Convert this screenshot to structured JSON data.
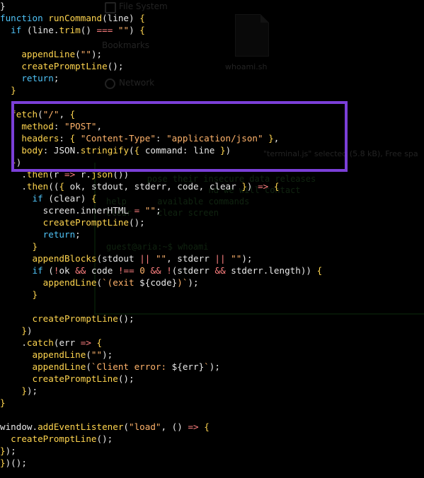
{
  "background_window": {
    "sidebar": {
      "file_system_label": "File System",
      "bookmarks_label": "Bookmarks",
      "network_label": "Network"
    },
    "file_icon_name": "whoami.sh",
    "status_text": "\"terminal.js\" selected (5.8 kB), Free spa",
    "terminal_lines": [
      "        pose their insecure data releases",
      "                    nd we will contact",
      "help      available commands",
      "clear     clear screen",
      "",
      "guest@aria:~$ whoami"
    ]
  },
  "highlight": {
    "color": "#7b3fd8",
    "label": "fetch-call-highlight"
  },
  "code_lines": [
    [
      [
        "p",
        "}"
      ]
    ],
    [
      [
        "kw",
        "function "
      ],
      [
        "fn",
        "runCommand"
      ],
      [
        "p",
        "("
      ],
      [
        "pl",
        "line"
      ],
      [
        "p",
        ") "
      ],
      [
        "br",
        "{"
      ]
    ],
    [
      [
        "p",
        "  "
      ],
      [
        "kw",
        "if "
      ],
      [
        "p",
        "("
      ],
      [
        "pl",
        "line"
      ],
      [
        "p",
        "."
      ],
      [
        "fn",
        "trim"
      ],
      [
        "p",
        "() "
      ],
      [
        "op",
        "==="
      ],
      [
        "p",
        " "
      ],
      [
        "str",
        "\"\""
      ],
      [
        "p",
        ") "
      ],
      [
        "br",
        "{"
      ]
    ],
    [
      [
        "p",
        ""
      ]
    ],
    [
      [
        "p",
        "    "
      ],
      [
        "fn",
        "appendLine"
      ],
      [
        "p",
        "("
      ],
      [
        "str",
        "\"\""
      ],
      [
        "p",
        ");"
      ]
    ],
    [
      [
        "p",
        "    "
      ],
      [
        "fn",
        "createPromptLine"
      ],
      [
        "p",
        "();"
      ]
    ],
    [
      [
        "p",
        "    "
      ],
      [
        "kw",
        "return"
      ],
      [
        "p",
        ";"
      ]
    ],
    [
      [
        "p",
        "  "
      ],
      [
        "br",
        "}"
      ]
    ],
    [
      [
        "p",
        ""
      ]
    ],
    [
      [
        "p",
        "  "
      ],
      [
        "fn",
        "fetch"
      ],
      [
        "p",
        "("
      ],
      [
        "str",
        "\"/\""
      ],
      [
        "p",
        ", "
      ],
      [
        "br",
        "{"
      ]
    ],
    [
      [
        "p",
        "    "
      ],
      [
        "fn",
        "method"
      ],
      [
        "p",
        ": "
      ],
      [
        "str",
        "\"POST\""
      ],
      [
        "p",
        ","
      ]
    ],
    [
      [
        "p",
        "    "
      ],
      [
        "fn",
        "headers"
      ],
      [
        "p",
        ": "
      ],
      [
        "br",
        "{ "
      ],
      [
        "str",
        "\"Content-Type\""
      ],
      [
        "p",
        ": "
      ],
      [
        "str",
        "\"application/json\""
      ],
      [
        "br",
        " }"
      ],
      [
        "p",
        ","
      ]
    ],
    [
      [
        "p",
        "    "
      ],
      [
        "fn",
        "body"
      ],
      [
        "p",
        ": "
      ],
      [
        "pl",
        "JSON"
      ],
      [
        "p",
        "."
      ],
      [
        "fn",
        "stringify"
      ],
      [
        "p",
        "("
      ],
      [
        "br",
        "{ "
      ],
      [
        "pl",
        "command"
      ],
      [
        "p",
        ": "
      ],
      [
        "pl",
        "line"
      ],
      [
        "br",
        " }"
      ],
      [
        "p",
        ")"
      ]
    ],
    [
      [
        "p",
        "  "
      ],
      [
        "br",
        "}"
      ],
      [
        "p",
        ")"
      ]
    ],
    [
      [
        "p",
        "    ."
      ],
      [
        "fn",
        "then"
      ],
      [
        "p",
        "("
      ],
      [
        "pl",
        "r"
      ],
      [
        "p",
        " "
      ],
      [
        "op",
        "=>"
      ],
      [
        "p",
        " "
      ],
      [
        "pl",
        "r"
      ],
      [
        "p",
        "."
      ],
      [
        "fn",
        "json"
      ],
      [
        "p",
        "())"
      ]
    ],
    [
      [
        "p",
        "    ."
      ],
      [
        "fn",
        "then"
      ],
      [
        "p",
        "(("
      ],
      [
        "br",
        "{ "
      ],
      [
        "pl",
        "ok"
      ],
      [
        "p",
        ", "
      ],
      [
        "pl",
        "stdout"
      ],
      [
        "p",
        ", "
      ],
      [
        "pl",
        "stderr"
      ],
      [
        "p",
        ", "
      ],
      [
        "pl",
        "code"
      ],
      [
        "p",
        ", "
      ],
      [
        "pl",
        "clear"
      ],
      [
        "br",
        " }"
      ],
      [
        "p",
        ") "
      ],
      [
        "op",
        "=>"
      ],
      [
        "p",
        " "
      ],
      [
        "br",
        "{"
      ]
    ],
    [
      [
        "p",
        "      "
      ],
      [
        "kw",
        "if "
      ],
      [
        "p",
        "("
      ],
      [
        "pl",
        "clear"
      ],
      [
        "p",
        ") "
      ],
      [
        "br",
        "{"
      ]
    ],
    [
      [
        "p",
        "        "
      ],
      [
        "pl",
        "screen"
      ],
      [
        "p",
        "."
      ],
      [
        "pl",
        "innerHTML"
      ],
      [
        "p",
        " "
      ],
      [
        "op",
        "="
      ],
      [
        "p",
        " "
      ],
      [
        "str",
        "\"\""
      ],
      [
        "p",
        ";"
      ]
    ],
    [
      [
        "p",
        "        "
      ],
      [
        "fn",
        "createPromptLine"
      ],
      [
        "p",
        "();"
      ]
    ],
    [
      [
        "p",
        "        "
      ],
      [
        "kw",
        "return"
      ],
      [
        "p",
        ";"
      ]
    ],
    [
      [
        "p",
        "      "
      ],
      [
        "br",
        "}"
      ]
    ],
    [
      [
        "p",
        "      "
      ],
      [
        "fn",
        "appendBlocks"
      ],
      [
        "p",
        "("
      ],
      [
        "pl",
        "stdout"
      ],
      [
        "p",
        " "
      ],
      [
        "op",
        "||"
      ],
      [
        "p",
        " "
      ],
      [
        "str",
        "\"\""
      ],
      [
        "p",
        ", "
      ],
      [
        "pl",
        "stderr"
      ],
      [
        "p",
        " "
      ],
      [
        "op",
        "||"
      ],
      [
        "p",
        " "
      ],
      [
        "str",
        "\"\""
      ],
      [
        "p",
        ");"
      ]
    ],
    [
      [
        "p",
        "      "
      ],
      [
        "kw",
        "if "
      ],
      [
        "p",
        "("
      ],
      [
        "op",
        "!"
      ],
      [
        "pl",
        "ok"
      ],
      [
        "p",
        " "
      ],
      [
        "op",
        "&&"
      ],
      [
        "p",
        " "
      ],
      [
        "pl",
        "code"
      ],
      [
        "p",
        " "
      ],
      [
        "op",
        "!=="
      ],
      [
        "p",
        " "
      ],
      [
        "str",
        "0"
      ],
      [
        "p",
        " "
      ],
      [
        "op",
        "&&"
      ],
      [
        "p",
        " "
      ],
      [
        "op",
        "!"
      ],
      [
        "p",
        "("
      ],
      [
        "pl",
        "stderr"
      ],
      [
        "p",
        " "
      ],
      [
        "op",
        "&&"
      ],
      [
        "p",
        " "
      ],
      [
        "pl",
        "stderr"
      ],
      [
        "p",
        "."
      ],
      [
        "pl",
        "length"
      ],
      [
        "p",
        ")) "
      ],
      [
        "br",
        "{"
      ]
    ],
    [
      [
        "p",
        "        "
      ],
      [
        "fn",
        "appendLine"
      ],
      [
        "p",
        "("
      ],
      [
        "str",
        "`(exit "
      ],
      [
        "pl",
        "${code}"
      ],
      [
        "str",
        ")`"
      ],
      [
        "p",
        ");"
      ]
    ],
    [
      [
        "p",
        "      "
      ],
      [
        "br",
        "}"
      ]
    ],
    [
      [
        "p",
        ""
      ]
    ],
    [
      [
        "p",
        "      "
      ],
      [
        "fn",
        "createPromptLine"
      ],
      [
        "p",
        "();"
      ]
    ],
    [
      [
        "p",
        "    "
      ],
      [
        "br",
        "}"
      ],
      [
        "p",
        ")"
      ]
    ],
    [
      [
        "p",
        "    ."
      ],
      [
        "fn",
        "catch"
      ],
      [
        "p",
        "("
      ],
      [
        "pl",
        "err"
      ],
      [
        "p",
        " "
      ],
      [
        "op",
        "=>"
      ],
      [
        "p",
        " "
      ],
      [
        "br",
        "{"
      ]
    ],
    [
      [
        "p",
        "      "
      ],
      [
        "fn",
        "appendLine"
      ],
      [
        "p",
        "("
      ],
      [
        "str",
        "\"\""
      ],
      [
        "p",
        ");"
      ]
    ],
    [
      [
        "p",
        "      "
      ],
      [
        "fn",
        "appendLine"
      ],
      [
        "p",
        "("
      ],
      [
        "str",
        "`Client error: "
      ],
      [
        "pl",
        "${err}"
      ],
      [
        "str",
        "`"
      ],
      [
        "p",
        ");"
      ]
    ],
    [
      [
        "p",
        "      "
      ],
      [
        "fn",
        "createPromptLine"
      ],
      [
        "p",
        "();"
      ]
    ],
    [
      [
        "p",
        "    "
      ],
      [
        "br",
        "}"
      ],
      [
        "p",
        ");"
      ]
    ],
    [
      [
        "br",
        "}"
      ]
    ],
    [
      [
        "p",
        ""
      ]
    ],
    [
      [
        "pl",
        "window"
      ],
      [
        "p",
        "."
      ],
      [
        "fn",
        "addEventListener"
      ],
      [
        "p",
        "("
      ],
      [
        "str",
        "\"load\""
      ],
      [
        "p",
        ", () "
      ],
      [
        "op",
        "=>"
      ],
      [
        "p",
        " "
      ],
      [
        "br",
        "{"
      ]
    ],
    [
      [
        "p",
        "  "
      ],
      [
        "fn",
        "createPromptLine"
      ],
      [
        "p",
        "();"
      ]
    ],
    [
      [
        "br",
        "}"
      ],
      [
        "p",
        ");"
      ]
    ],
    [
      [
        "br",
        "}"
      ],
      [
        "p",
        ")();"
      ]
    ]
  ]
}
